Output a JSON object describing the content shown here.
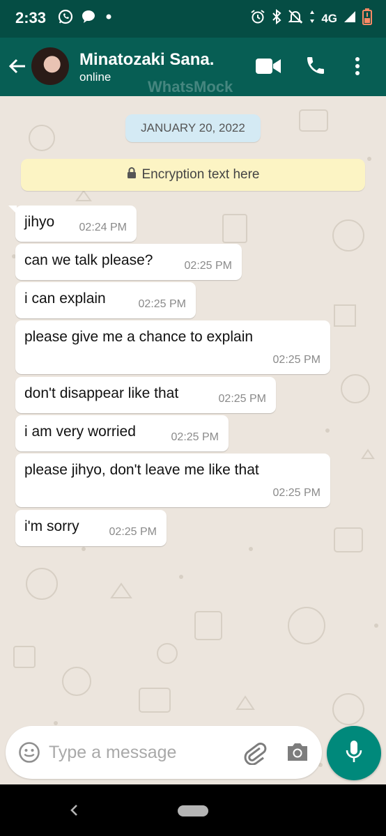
{
  "status_bar": {
    "time": "2:33",
    "network": "4G",
    "icons": [
      "whatsapp-icon",
      "message-bubble-icon",
      "dot-icon",
      "alarm-icon",
      "bluetooth-icon",
      "mute-icon",
      "signal-icon",
      "battery-icon"
    ]
  },
  "toolbar": {
    "contact_name": "Minatozaki Sana.",
    "status": "online",
    "watermark": "WhatsMock",
    "icons": [
      "back-arrow-icon",
      "video-call-icon",
      "phone-icon",
      "more-vert-icon"
    ]
  },
  "chat": {
    "date": "JANUARY 20, 2022",
    "encryption": "Encryption text here",
    "messages": [
      {
        "text": "jihyo",
        "time": "02:24 PM"
      },
      {
        "text": "can we talk please?",
        "time": "02:25 PM"
      },
      {
        "text": "i can explain",
        "time": "02:25 PM"
      },
      {
        "text": "please give me a chance to explain",
        "time": "02:25 PM"
      },
      {
        "text": "don't disappear like that",
        "time": "02:25 PM"
      },
      {
        "text": "i am very worried",
        "time": "02:25 PM"
      },
      {
        "text": "please jihyo, don't leave me like that",
        "time": "02:25 PM"
      },
      {
        "text": "i'm sorry",
        "time": "02:25 PM"
      }
    ]
  },
  "input": {
    "placeholder": "Type a message",
    "value": ""
  },
  "colors": {
    "header": "#075e54",
    "status_bar": "#054d44",
    "chat_background": "#ece5dd",
    "date_chip": "#d4eaf4",
    "encryption_chip": "#fcf4c4",
    "fab": "#00897b"
  }
}
